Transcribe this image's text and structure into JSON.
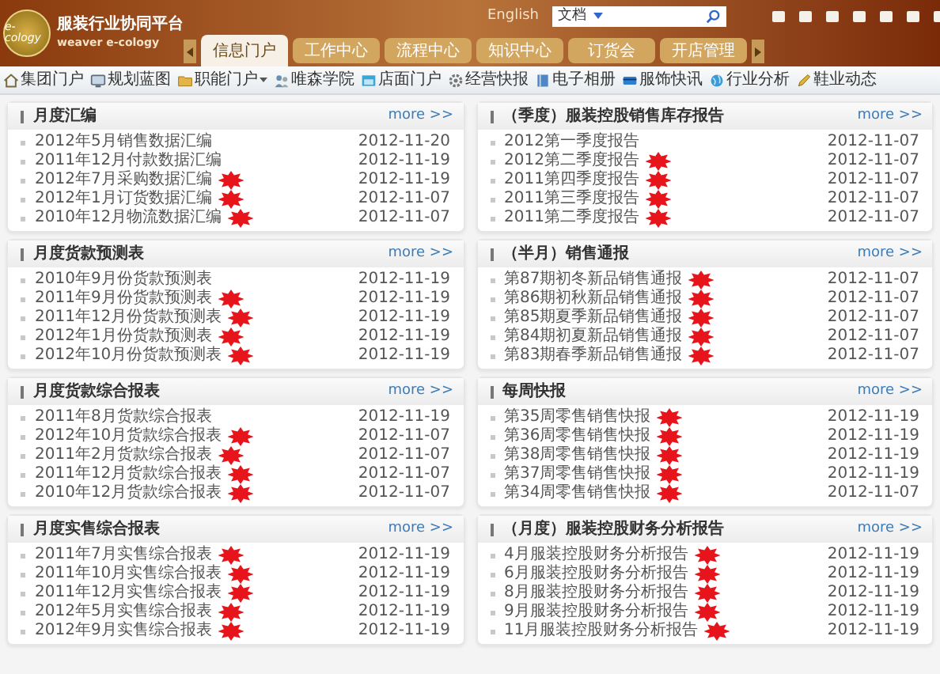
{
  "header": {
    "logo": "e-cology",
    "title": "服装行业协同平台",
    "subtitle": "weaver e-cology",
    "language_link": "English",
    "search_scope": "文档"
  },
  "main_tabs": [
    {
      "label": "信息门户",
      "selected": true
    },
    {
      "label": "工作中心",
      "selected": false
    },
    {
      "label": "流程中心",
      "selected": false
    },
    {
      "label": "知识中心",
      "selected": false
    },
    {
      "label": "订货会",
      "selected": false
    },
    {
      "label": "开店管理",
      "selected": false
    }
  ],
  "toolbar": [
    {
      "label": "集团门户",
      "dropdown": false
    },
    {
      "label": "规划蓝图",
      "dropdown": false
    },
    {
      "label": "职能门户",
      "dropdown": true
    },
    {
      "label": "唯森学院",
      "dropdown": false
    },
    {
      "label": "店面门户",
      "dropdown": false
    },
    {
      "label": "经营快报",
      "dropdown": false
    },
    {
      "label": "电子相册",
      "dropdown": false
    },
    {
      "label": "服饰快讯",
      "dropdown": false
    },
    {
      "label": "行业分析",
      "dropdown": false
    },
    {
      "label": "鞋业动态",
      "dropdown": false
    }
  ],
  "panels": [
    {
      "title": "月度汇编",
      "more": "more >>",
      "items": [
        {
          "title": "2012年5月销售数据汇编",
          "date": "2012-11-20",
          "new": false
        },
        {
          "title": "2011年12月付款数据汇编",
          "date": "2012-11-19",
          "new": false
        },
        {
          "title": "2012年7月采购数据汇编",
          "date": "2012-11-19",
          "new": true
        },
        {
          "title": "2012年1月订货数据汇编",
          "date": "2012-11-07",
          "new": true
        },
        {
          "title": "2010年12月物流数据汇编",
          "date": "2012-11-07",
          "new": true
        }
      ]
    },
    {
      "title": "（季度）服装控股销售库存报告",
      "more": "more >>",
      "items": [
        {
          "title": "2012第一季度报告",
          "date": "2012-11-07",
          "new": false
        },
        {
          "title": "2012第二季度报告",
          "date": "2012-11-07",
          "new": true
        },
        {
          "title": "2011第四季度报告",
          "date": "2012-11-07",
          "new": true
        },
        {
          "title": "2011第三季度报告",
          "date": "2012-11-07",
          "new": true
        },
        {
          "title": "2011第二季度报告",
          "date": "2012-11-07",
          "new": true
        }
      ]
    },
    {
      "title": "月度货款预测表",
      "more": "more >>",
      "items": [
        {
          "title": "2010年9月份货款预测表",
          "date": "2012-11-19",
          "new": false
        },
        {
          "title": "2011年9月份货款预测表",
          "date": "2012-11-19",
          "new": true
        },
        {
          "title": "2011年12月份货款预测表",
          "date": "2012-11-19",
          "new": true
        },
        {
          "title": "2012年1月份货款预测表",
          "date": "2012-11-19",
          "new": true
        },
        {
          "title": "2012年10月份货款预测表",
          "date": "2012-11-19",
          "new": true
        }
      ]
    },
    {
      "title": "（半月）销售通报",
      "more": "more >>",
      "items": [
        {
          "title": "第87期初冬新品销售通报",
          "date": "2012-11-07",
          "new": true
        },
        {
          "title": "第86期初秋新品销售通报",
          "date": "2012-11-07",
          "new": true
        },
        {
          "title": "第85期夏季新品销售通报",
          "date": "2012-11-07",
          "new": true
        },
        {
          "title": "第84期初夏新品销售通报",
          "date": "2012-11-07",
          "new": true
        },
        {
          "title": "第83期春季新品销售通报",
          "date": "2012-11-07",
          "new": true
        }
      ]
    },
    {
      "title": "月度货款综合报表",
      "more": "more >>",
      "items": [
        {
          "title": "2011年8月货款综合报表",
          "date": "2012-11-19",
          "new": false
        },
        {
          "title": "2012年10月货款综合报表",
          "date": "2012-11-07",
          "new": true
        },
        {
          "title": "2011年2月货款综合报表",
          "date": "2012-11-07",
          "new": true
        },
        {
          "title": "2011年12月货款综合报表",
          "date": "2012-11-07",
          "new": true
        },
        {
          "title": "2010年12月货款综合报表",
          "date": "2012-11-07",
          "new": true
        }
      ]
    },
    {
      "title": "每周快报",
      "more": "more >>",
      "items": [
        {
          "title": "第35周零售销售快报",
          "date": "2012-11-19",
          "new": true
        },
        {
          "title": "第36周零售销售快报",
          "date": "2012-11-19",
          "new": true
        },
        {
          "title": "第38周零售销售快报",
          "date": "2012-11-19",
          "new": true
        },
        {
          "title": "第37周零售销售快报",
          "date": "2012-11-19",
          "new": true
        },
        {
          "title": "第34周零售销售快报",
          "date": "2012-11-07",
          "new": true
        }
      ]
    },
    {
      "title": "月度实售综合报表",
      "more": "more >>",
      "items": [
        {
          "title": "2011年7月实售综合报表",
          "date": "2012-11-19",
          "new": true
        },
        {
          "title": "2011年10月实售综合报表",
          "date": "2012-11-19",
          "new": true
        },
        {
          "title": "2011年12月实售综合报表",
          "date": "2012-11-19",
          "new": true
        },
        {
          "title": "2012年5月实售综合报表",
          "date": "2012-11-19",
          "new": true
        },
        {
          "title": "2012年9月实售综合报表",
          "date": "2012-11-19",
          "new": true
        }
      ]
    },
    {
      "title": "（月度）服装控股财务分析报告",
      "more": "more >>",
      "items": [
        {
          "title": "4月服装控股财务分析报告",
          "date": "2012-11-19",
          "new": true
        },
        {
          "title": "6月服装控股财务分析报告",
          "date": "2012-11-19",
          "new": true
        },
        {
          "title": "8月服装控股财务分析报告",
          "date": "2012-11-19",
          "new": true
        },
        {
          "title": "9月服装控股财务分析报告",
          "date": "2012-11-19",
          "new": true
        },
        {
          "title": "11月服装控股财务分析报告",
          "date": "2012-11-19",
          "new": true
        }
      ]
    }
  ]
}
